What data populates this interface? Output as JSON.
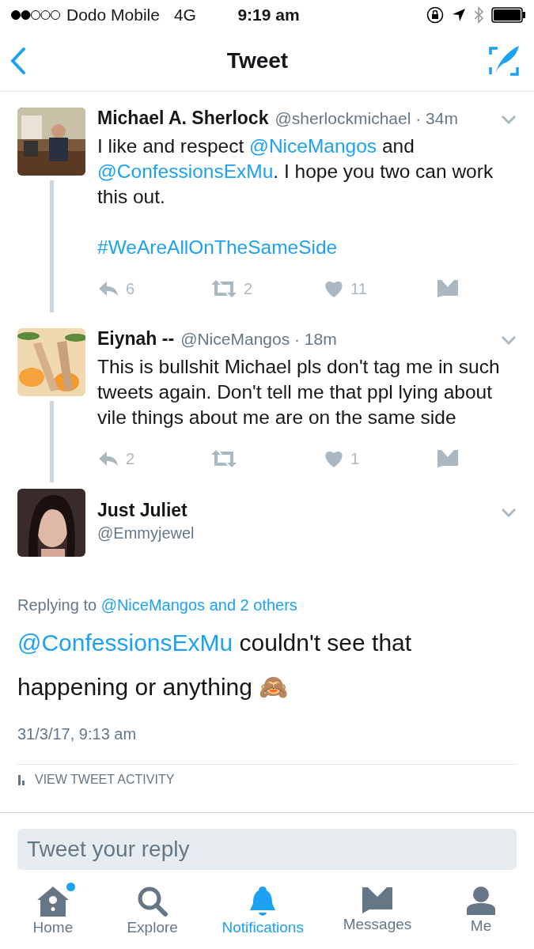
{
  "status_bar": {
    "carrier": "Dodo Mobile",
    "network": "4G",
    "time": "9:19 am"
  },
  "nav": {
    "title": "Tweet"
  },
  "thread": [
    {
      "name": "Michael A. Sherlock",
      "handle": "@sherlockmichael",
      "separator": "·",
      "time": "34m",
      "connector": true,
      "paragraphs": [
        [
          {
            "kind": "text",
            "text": "I like and respect "
          },
          {
            "kind": "mention",
            "text": "@NiceMangos"
          },
          {
            "kind": "text",
            "text": " and "
          },
          {
            "kind": "mention",
            "text": "@ConfessionsExMu"
          },
          {
            "kind": "text",
            "text": ". I hope you two can work this out."
          }
        ],
        [
          {
            "kind": "hashtag",
            "text": "#WeAreAllOnTheSameSide"
          }
        ]
      ],
      "actions": [
        {
          "kind": "reply",
          "count": "6"
        },
        {
          "kind": "retweet",
          "count": "2"
        },
        {
          "kind": "like",
          "count": "11"
        },
        {
          "kind": "message"
        }
      ]
    },
    {
      "name": "Eiynah --",
      "handle": "@NiceMangos",
      "separator": "·",
      "time": "18m",
      "connector": true,
      "paragraphs": [
        [
          {
            "kind": "text",
            "text": "This is bullshit Michael pls don't tag me in such tweets again. Don't tell me that ppl lying about vile things about me are on the same side"
          }
        ]
      ],
      "actions": [
        {
          "kind": "reply",
          "count": "2"
        },
        {
          "kind": "retweet"
        },
        {
          "kind": "like",
          "count": "1"
        },
        {
          "kind": "message"
        }
      ]
    }
  ],
  "focused": {
    "name": "Just Juliet",
    "handle": "@Emmyjewel",
    "replying_to": [
      {
        "kind": "text",
        "text": "Replying to "
      },
      {
        "kind": "mention",
        "text": "@NiceMangos and 2 others"
      }
    ],
    "body": [
      {
        "kind": "mention",
        "text": "@ConfessionsExMu"
      },
      {
        "kind": "text",
        "text": " couldn't see that happening or anything 🙈"
      }
    ],
    "date": "31/3/17, 9:13 am",
    "activity": "VIEW TWEET ACTIVITY"
  },
  "reply": {
    "placeholder": "Tweet your reply"
  },
  "tabs": [
    {
      "label": "Home",
      "kind": "home",
      "selected": false,
      "dot": true
    },
    {
      "label": "Explore",
      "kind": "explore",
      "selected": false,
      "dot": false
    },
    {
      "label": "Notifications",
      "kind": "notifications",
      "selected": true,
      "dot": false
    },
    {
      "label": "Messages",
      "kind": "messages",
      "selected": false,
      "dot": false
    },
    {
      "label": "Me",
      "kind": "me",
      "selected": false,
      "dot": false
    }
  ]
}
